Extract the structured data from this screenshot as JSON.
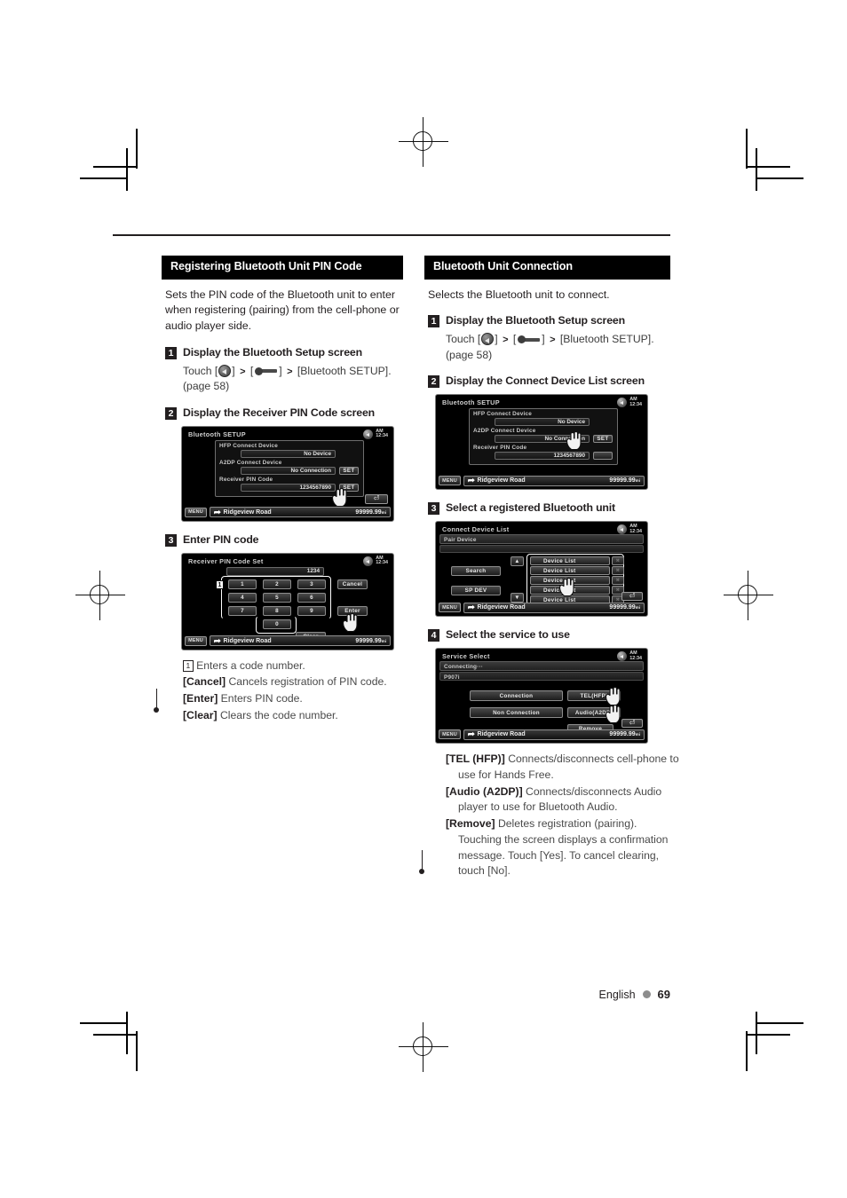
{
  "page": {
    "footer_language": "English",
    "page_number": "69"
  },
  "left_column": {
    "section_title": "Registering Bluetooth Unit PIN Code",
    "intro": "Sets the PIN code of the Bluetooth unit to enter when registering (pairing) from the cell-phone or audio player side.",
    "steps": [
      {
        "number": "1",
        "title": "Display the Bluetooth Setup screen",
        "touch_prefix": "Touch [",
        "touch_mid": "] ",
        "touch_sep": ">",
        "touch_open2": " [",
        "touch_close2": "] ",
        "touch_target": "[Bluetooth SETUP].",
        "page_ref": "(page 58)"
      },
      {
        "number": "2",
        "title": "Display the Receiver PIN Code screen"
      },
      {
        "number": "3",
        "title": "Enter PIN code"
      }
    ],
    "screen_setup": {
      "title": "Bluetooth SETUP",
      "clock_ampm": "AM",
      "clock_time": "12:34",
      "rows": [
        {
          "label": "HFP Connect Device",
          "value": "No Device",
          "button": ""
        },
        {
          "label": "A2DP Connect Device",
          "value": "No Connection",
          "button": "SET"
        },
        {
          "label": "Receiver PIN Code",
          "value": "1234567890",
          "button": "SET"
        }
      ],
      "back_icon": "back-arrow-icon",
      "menu_label": "MENU",
      "road_name": "Ridgeview Road",
      "distance": "99999.99",
      "distance_unit": "mi"
    },
    "screen_pin": {
      "title": "Receiver PIN Code Set",
      "clock_ampm": "AM",
      "clock_time": "12:34",
      "code_value": "1234",
      "callout_number": "1",
      "keys": [
        "1",
        "2",
        "3",
        "4",
        "5",
        "6",
        "7",
        "8",
        "9",
        "0"
      ],
      "cancel_label": "Cancel",
      "enter_label": "Enter",
      "clear_label": "Clear",
      "menu_label": "MENU",
      "road_name": "Ridgeview Road",
      "distance": "99999.99",
      "distance_unit": "mi"
    },
    "definitions": [
      {
        "term": "1",
        "term_is_box": true,
        "desc": "Enters a code number."
      },
      {
        "term": "[Cancel]",
        "term_is_box": false,
        "desc": "Cancels registration of PIN code."
      },
      {
        "term": "[Enter]",
        "term_is_box": false,
        "desc": "Enters PIN code."
      },
      {
        "term": "[Clear]",
        "term_is_box": false,
        "desc": "Clears the code number."
      }
    ]
  },
  "right_column": {
    "section_title": "Bluetooth Unit Connection",
    "intro": "Selects the Bluetooth unit to connect.",
    "steps": [
      {
        "number": "1",
        "title": "Display the Bluetooth Setup screen",
        "touch_prefix": "Touch [",
        "touch_target": "[Bluetooth SETUP].",
        "page_ref": "(page 58)"
      },
      {
        "number": "2",
        "title": "Display the Connect Device List screen"
      },
      {
        "number": "3",
        "title": "Select a registered Bluetooth unit"
      },
      {
        "number": "4",
        "title": "Select the service to use"
      }
    ],
    "screen_setup": {
      "title": "Bluetooth SETUP",
      "clock_ampm": "AM",
      "clock_time": "12:34",
      "rows": [
        {
          "label": "HFP Connect Device",
          "value": "No Device",
          "button": ""
        },
        {
          "label": "A2DP Connect Device",
          "value": "No Connection",
          "button": "SET"
        },
        {
          "label": "Receiver PIN Code",
          "value": "1234567890",
          "button": "SET"
        }
      ],
      "menu_label": "MENU",
      "road_name": "Ridgeview Road",
      "distance": "99999.99",
      "distance_unit": "mi"
    },
    "screen_device_list": {
      "title": "Connect Device List",
      "clock_ampm": "AM",
      "clock_time": "12:34",
      "subtitle": "Pair Device",
      "search_label": "Search",
      "spdev_label": "SP DEV",
      "device_rows": [
        "Device List",
        "Device List",
        "Device List",
        "Device List",
        "Device List"
      ],
      "menu_label": "MENU",
      "road_name": "Ridgeview Road",
      "distance": "99999.99",
      "distance_unit": "mi"
    },
    "screen_service_select": {
      "title": "Service Select",
      "clock_ampm": "AM",
      "clock_time": "12:34",
      "status": "Connecting···",
      "device_name": "P907i",
      "row1_left": "Connection",
      "row1_right": "TEL(HFP)",
      "row2_left": "Non Connection",
      "row2_right": "Audio(A2DP)",
      "remove_label": "Remove",
      "menu_label": "MENU",
      "road_name": "Ridgeview Road",
      "distance": "99999.99",
      "distance_unit": "mi"
    },
    "definitions": [
      {
        "term": "[TEL (HFP)]",
        "desc": "Connects/disconnects cell-phone to use for Hands Free."
      },
      {
        "term": "[Audio (A2DP)]",
        "desc": "Connects/disconnects Audio player to use for Bluetooth Audio."
      },
      {
        "term": "[Remove]",
        "desc": "Deletes registration (pairing). Touching the screen displays a confirmation message. Touch [Yes]. To cancel clearing, touch [No]."
      }
    ]
  }
}
